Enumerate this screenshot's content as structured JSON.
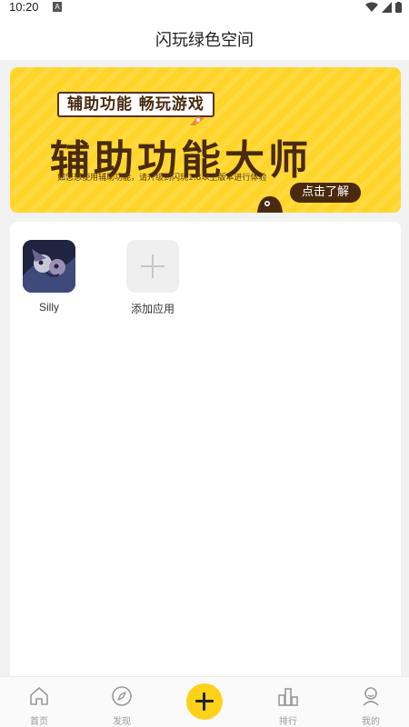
{
  "status_bar": {
    "time": "10:20",
    "notification_glyph": "A"
  },
  "header": {
    "title": "闪玩绿色空间"
  },
  "banner": {
    "tag": "辅助功能 畅玩游戏",
    "heading": "辅助功能大师",
    "subtitle": "如您想使用辅助功能，请升级到闪玩1.8以上版本进行体验",
    "button": "点击了解",
    "colors": {
      "background": "#ffd52a",
      "text": "#4a2a0f"
    }
  },
  "apps": [
    {
      "label": "Silly",
      "icon": "silly-app-icon"
    },
    {
      "label": "添加应用",
      "icon": "plus-icon"
    }
  ],
  "tabbar": {
    "items": [
      {
        "label": "首页",
        "icon": "home-icon"
      },
      {
        "label": "发现",
        "icon": "compass-icon"
      },
      {
        "label": "",
        "icon": "plus-icon"
      },
      {
        "label": "排行",
        "icon": "ranking-icon"
      },
      {
        "label": "我的",
        "icon": "profile-icon"
      }
    ],
    "accent": "#ffd21a"
  }
}
